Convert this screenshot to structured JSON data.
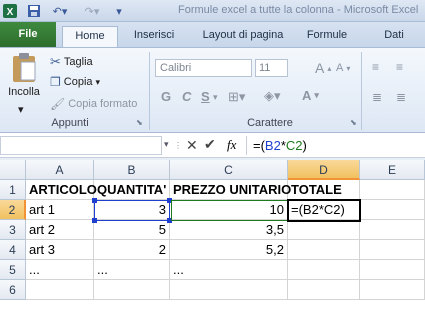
{
  "title_bar": {
    "title": "Formule excel a tutte la colonna - Microsoft Excel"
  },
  "tabs": [
    {
      "label": "File"
    },
    {
      "label": "Home"
    },
    {
      "label": "Inserisci"
    },
    {
      "label": "Layout di pagina"
    },
    {
      "label": "Formule"
    },
    {
      "label": "Dati"
    }
  ],
  "ribbon": {
    "clipboard": {
      "paste_label": "Incolla",
      "cut_label": "Taglia",
      "copy_label": "Copia",
      "format_painter_label": "Copia formato",
      "group_label": "Appunti"
    },
    "font": {
      "font_name": "Calibri",
      "font_size": "11",
      "bold": "G",
      "italic": "C",
      "underline": "S",
      "group_label": "Carattere"
    }
  },
  "formula_bar": {
    "name_box": "",
    "fx": "fx",
    "content_prefix": "=(",
    "content_ref1": "B2",
    "content_op": "*",
    "content_ref2": "C2",
    "content_suffix": ")"
  },
  "sheet": {
    "columns": [
      "A",
      "B",
      "C",
      "D",
      "E"
    ],
    "rows": [
      "1",
      "2",
      "3",
      "4",
      "5",
      "6"
    ],
    "cells": {
      "A1": "ARTICOLO",
      "B1": "QUANTITA'",
      "C1": "PREZZO UNITARIO",
      "D1": "TOTALE",
      "A2": "art 1",
      "B2": "3",
      "C2": "10",
      "D2": "=(B2*C2)",
      "A3": "art 2",
      "B3": "5",
      "C3": "3,5",
      "A4": "art 3",
      "B4": "2",
      "C4": "5,2",
      "A5": "...",
      "B5": "...",
      "C5": "..."
    }
  },
  "colors": {
    "file_tab": "#2d6d2d",
    "ref_blue": "#1f3fcf",
    "ref_green": "#1e7a1e",
    "selection_orange": "#f29436"
  }
}
